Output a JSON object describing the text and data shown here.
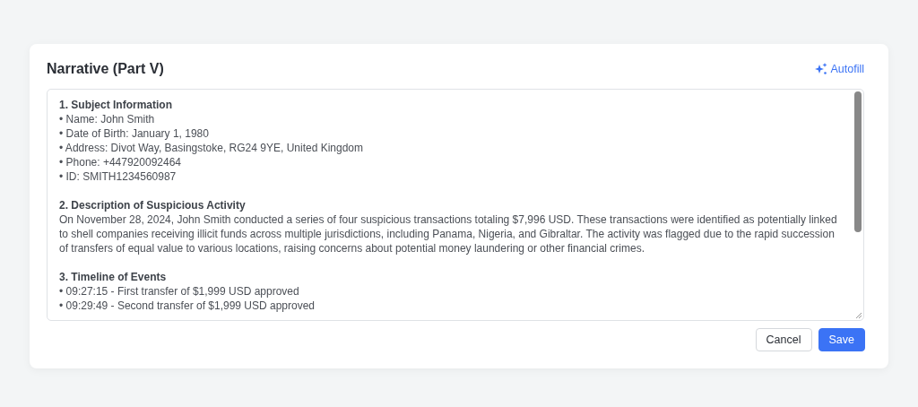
{
  "dialog": {
    "title": "Narrative (Part V)",
    "autofill": {
      "label": "Autofill"
    }
  },
  "narrative": {
    "sections": [
      {
        "heading": "1. Subject Information",
        "kind": "list",
        "items": [
          "• Name: John Smith",
          "• Date of Birth: January 1, 1980",
          "• Address: Divot Way, Basingstoke, RG24 9YE, United Kingdom",
          "• Phone: +447920092464",
          "• ID: SMITH1234560987"
        ]
      },
      {
        "heading": "2. Description of Suspicious Activity",
        "kind": "paragraph",
        "text": "On November 28, 2024, John Smith conducted a series of four suspicious transactions totaling $7,996 USD. These transactions were identified as potentially linked to shell companies receiving illicit funds across multiple jurisdictions, including Panama, Nigeria, and Gibraltar. The activity was flagged due to the rapid succession of transfers of equal value to various locations, raising concerns about potential money laundering or other financial crimes."
      },
      {
        "heading": "3. Timeline of Events",
        "kind": "list",
        "items": [
          "• 09:27:15 - First transfer of $1,999 USD approved",
          "• 09:29:49 - Second transfer of $1,999 USD approved"
        ]
      }
    ]
  },
  "buttons": [
    {
      "label": "Cancel",
      "kind": "secondary"
    },
    {
      "label": "Save",
      "kind": "primary"
    }
  ]
}
